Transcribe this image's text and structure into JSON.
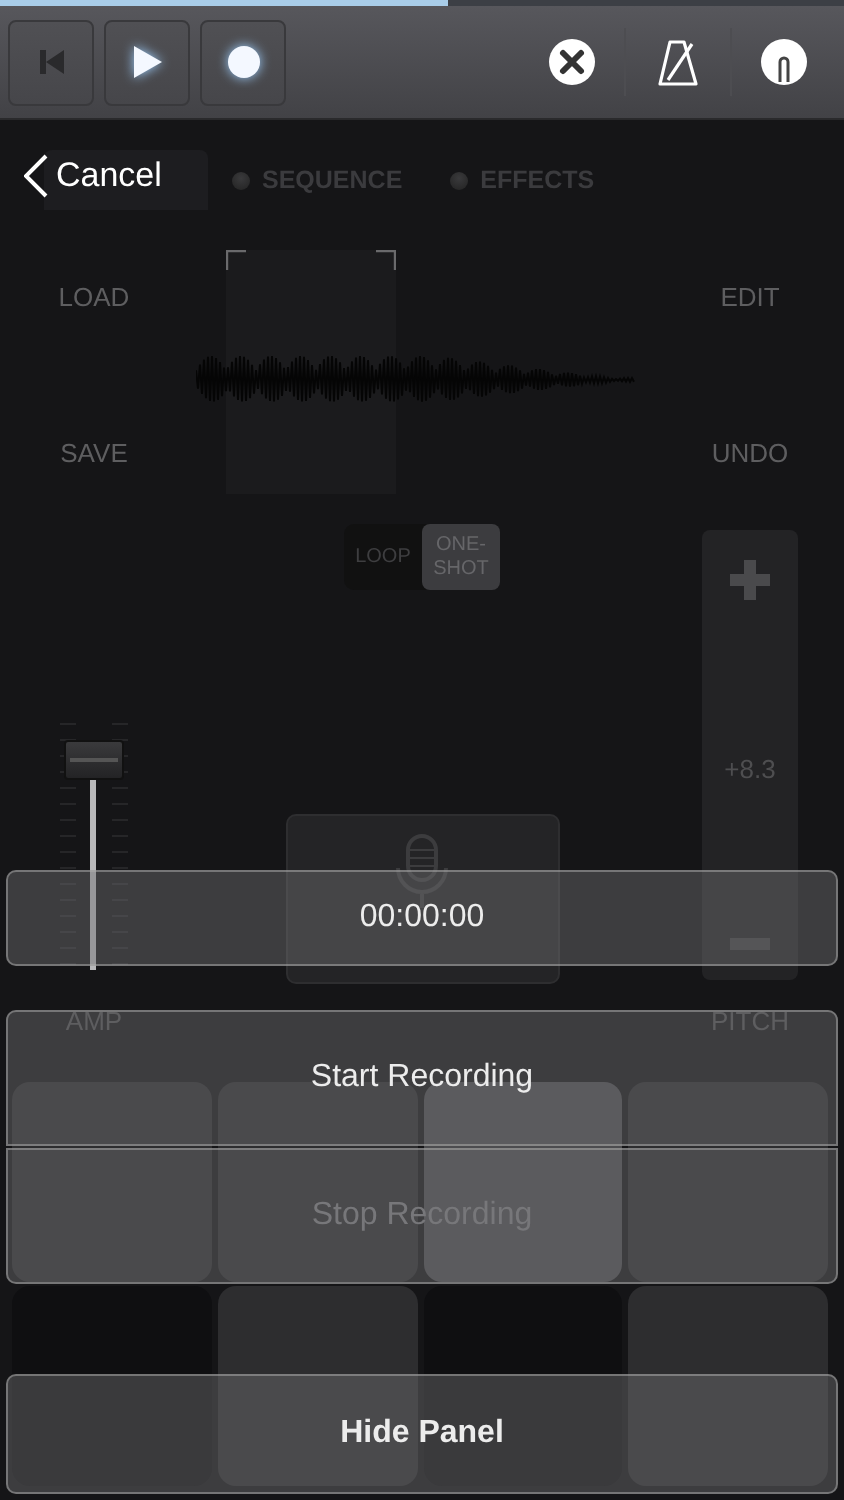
{
  "loading_bar": {
    "level": 0.53
  },
  "transport": [
    {
      "kind": "rewind",
      "lit": false
    },
    {
      "kind": "play",
      "lit": true
    },
    {
      "kind": "record",
      "lit": true
    }
  ],
  "toolbar_icons": [
    {
      "kind": "close"
    },
    {
      "kind": "metronome"
    },
    {
      "kind": "tuner"
    }
  ],
  "tabs": [
    {
      "selected": true
    },
    {
      "label": "SEQUENCE",
      "selected": false
    },
    {
      "label": "EFFECTS",
      "selected": false
    }
  ],
  "left_buttons": [
    "LOAD",
    "SAVE"
  ],
  "right_buttons": [
    "EDIT",
    "UNDO"
  ],
  "play_mode": [
    {
      "label": "LOOP",
      "selected": false
    },
    {
      "label": "ONE-SHOT",
      "selected": true
    }
  ],
  "amp": {
    "label": "AMP",
    "level": 0.84
  },
  "pitch": {
    "label": "PITCH",
    "reading": "+8.3"
  },
  "pads": [
    {
      "kind": "pad",
      "lit": false
    },
    {
      "kind": "pad",
      "lit": false
    },
    {
      "kind": "pad",
      "lit": true
    },
    {
      "kind": "pad",
      "lit": false
    },
    {
      "kind": "blank",
      "lit": false
    },
    {
      "kind": "pad",
      "lit": false
    },
    {
      "kind": "blank",
      "lit": false
    },
    {
      "kind": "pad",
      "lit": false
    }
  ],
  "panel": {
    "cancel": "Cancel",
    "timer": "00:00:00",
    "buttons": [
      {
        "label": "Start Recording",
        "disabled": false
      },
      {
        "label": "Stop Recording",
        "disabled": true
      }
    ],
    "hide": "Hide Panel"
  }
}
